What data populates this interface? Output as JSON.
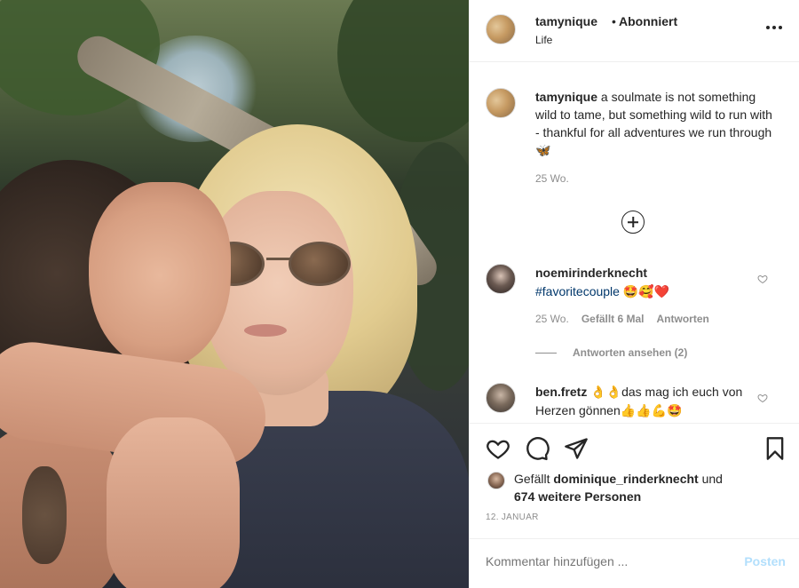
{
  "header": {
    "username": "tamynique",
    "separator": "•",
    "follow_status": "Abonniert",
    "location": "Life",
    "more_icon": "more-horizontal-icon"
  },
  "caption": {
    "username": "tamynique",
    "text": "a soulmate is not something wild to tame, but something wild to run with - thankful for all adventures we run through 🦋",
    "time": "25 Wo."
  },
  "load_more_icon": "plus-circle-icon",
  "comments": [
    {
      "username": "noemirinderknecht",
      "hashtag": "#favoritecouple",
      "text": "🤩🥰❤️",
      "time": "25 Wo.",
      "likes": "Gefällt 6 Mal",
      "reply": "Antworten",
      "view_replies": "Antworten ansehen (2)"
    },
    {
      "username": "ben.fretz",
      "text": "👌👌das mag ich euch von Herzen gönnen👍👍💪🤩"
    }
  ],
  "likes": {
    "prefix": "Gefällt",
    "user": "dominique_rinderknecht",
    "conjunction": "und",
    "others": "674 weitere Personen"
  },
  "date": "12. JANUAR",
  "comment_input": {
    "placeholder": "Kommentar hinzufügen ...",
    "post_label": "Posten"
  },
  "colors": {
    "text": "#262626",
    "secondary": "#8e8e8e",
    "link": "#00376b",
    "post_disabled": "#b2dffc"
  }
}
